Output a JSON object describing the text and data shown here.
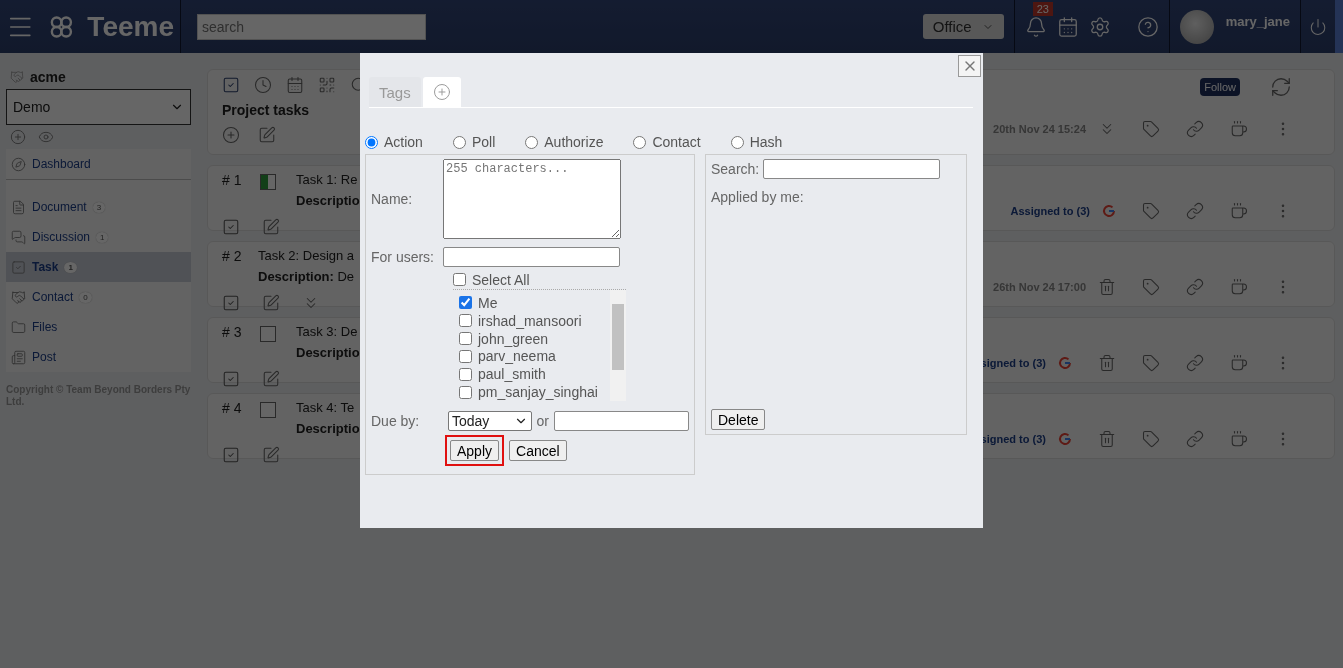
{
  "header": {
    "logo": "Teeme",
    "search_placeholder": "search",
    "workspace": "Office",
    "notifications": "23",
    "user": "mary_jane"
  },
  "sidebar": {
    "org": "acme",
    "space": "Demo",
    "items": [
      {
        "label": "Dashboard",
        "kind": "dashboard",
        "selected": false
      },
      {
        "label": "Document",
        "kind": "document",
        "count": "3",
        "selected": false
      },
      {
        "label": "Discussion",
        "kind": "discussion",
        "count": "1",
        "selected": false
      },
      {
        "label": "Task",
        "kind": "task",
        "count": "1",
        "selected": true
      },
      {
        "label": "Contact",
        "kind": "contact",
        "count": "0",
        "selected": false
      },
      {
        "label": "Files",
        "kind": "files",
        "selected": false
      },
      {
        "label": "Post",
        "kind": "post",
        "selected": false
      }
    ],
    "copyright": "Copyright © Team Beyond Borders Pty Ltd."
  },
  "project": {
    "title": "Project tasks",
    "follow": "Follow",
    "date": "20th Nov 24 15:24"
  },
  "tasks": [
    {
      "number": "# 1",
      "checkbox": true,
      "in_progress": true,
      "title": "Task 1: Re",
      "desc_label": "Descriptio",
      "expand": false,
      "info": "Assigned to (3)",
      "assigned": true,
      "google": true,
      "trash": false
    },
    {
      "number": "# 2",
      "checkbox": false,
      "title": "Task 2: Design a",
      "desc_label": "Description:",
      "desc_text": "De",
      "expand": true,
      "info": "26th Nov 24 17:00",
      "assigned": false,
      "google": false,
      "trash": true
    },
    {
      "number": "# 3",
      "checkbox": true,
      "in_progress": false,
      "title": "Task 3: De",
      "desc_label": "Descriptio",
      "expand": false,
      "info": "signed to (3)",
      "assigned": true,
      "google": true,
      "trash": true
    },
    {
      "number": "# 4",
      "checkbox": true,
      "in_progress": false,
      "title": "Task 4: Te",
      "desc_label": "Descriptio",
      "expand": false,
      "info": "signed to (3)",
      "assigned": true,
      "google": true,
      "trash": true
    }
  ],
  "dialog": {
    "tabs": [
      {
        "label": "Tags",
        "kind": "text",
        "selected": false
      },
      {
        "kind": "add",
        "selected": true
      }
    ],
    "types": [
      {
        "label": "Action",
        "selected": true
      },
      {
        "label": "Poll",
        "selected": false
      },
      {
        "label": "Authorize",
        "selected": false
      },
      {
        "label": "Contact",
        "selected": false
      },
      {
        "label": "Hash",
        "selected": false
      }
    ],
    "name_label": "Name:",
    "name_placeholder": "255 characters...",
    "users_label": "For users:",
    "select_all": {
      "label": "Select All",
      "checked": false
    },
    "users": [
      {
        "name": "Me",
        "checked": true
      },
      {
        "name": "irshad_mansoori",
        "checked": false
      },
      {
        "name": "john_green",
        "checked": false
      },
      {
        "name": "parv_neema",
        "checked": false
      },
      {
        "name": "paul_smith",
        "checked": false
      },
      {
        "name": "pm_sanjay_singhai",
        "checked": false
      }
    ],
    "due_label": "Due by:",
    "due_value": "Today",
    "or": "or",
    "apply": {
      "label": "Apply",
      "highlighted": true
    },
    "cancel": "Cancel",
    "search_label": "Search:",
    "applied_label": "Applied by me:",
    "delete": "Delete"
  }
}
